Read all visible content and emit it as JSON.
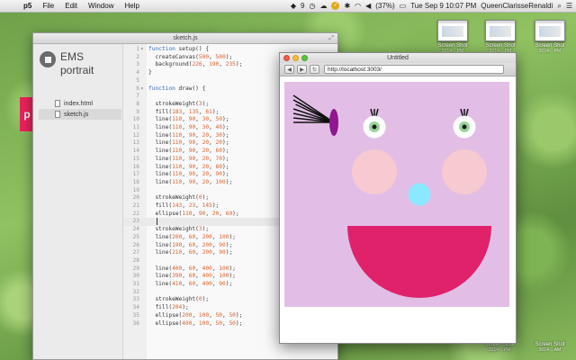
{
  "menubar": {
    "apple": "",
    "app_name": "p5",
    "items": [
      "File",
      "Edit",
      "Window",
      "Help"
    ],
    "status": {
      "dropbox": "9",
      "battery": "(37%)",
      "clock": "Tue Sep 9  10:07 PM",
      "user": "QueenClarisseRenaldi"
    }
  },
  "desktop_files": [
    {
      "label": "Screen Shot",
      "sub": "2014-...PM"
    },
    {
      "label": "Screen Shot",
      "sub": "2014-...PM"
    },
    {
      "label": "Screen Shot",
      "sub": "2014-...PM"
    },
    {
      "label": "Screen Shot",
      "sub": "2014-...PM"
    },
    {
      "label": "Screen Shot",
      "sub": "2014-...AM"
    }
  ],
  "dock": {
    "p5_letter": "p"
  },
  "editor": {
    "window_title": "sketch.js",
    "project_name_line1": "EMS",
    "project_name_line2": "portrait",
    "files": [
      {
        "name": "index.html",
        "selected": false
      },
      {
        "name": "sketch.js",
        "selected": true
      }
    ],
    "active_line": 23,
    "code": [
      {
        "n": "1",
        "fold": "▾",
        "text": "function setup() {"
      },
      {
        "n": "2",
        "fold": "",
        "text": "  createCanvas(500, 500);"
      },
      {
        "n": "3",
        "fold": "",
        "text": "  background(226, 190, 235);"
      },
      {
        "n": "4",
        "fold": "",
        "text": "}"
      },
      {
        "n": "5",
        "fold": "",
        "text": ""
      },
      {
        "n": "6",
        "fold": "▾",
        "text": "function draw() {"
      },
      {
        "n": "7",
        "fold": "",
        "text": ""
      },
      {
        "n": "8",
        "fold": "",
        "text": "  strokeWeight(3);"
      },
      {
        "n": "9",
        "fold": "",
        "text": "  fill(183, 135, 61);"
      },
      {
        "n": "10",
        "fold": "",
        "text": "  line(110, 90, 30, 50);"
      },
      {
        "n": "11",
        "fold": "",
        "text": "  line(110, 90, 30, 40);"
      },
      {
        "n": "12",
        "fold": "",
        "text": "  line(110, 90, 20, 30);"
      },
      {
        "n": "13",
        "fold": "",
        "text": "  line(110, 90, 20, 20);"
      },
      {
        "n": "14",
        "fold": "",
        "text": "  line(110, 90, 20, 60);"
      },
      {
        "n": "15",
        "fold": "",
        "text": "  line(110, 90, 20, 70);"
      },
      {
        "n": "16",
        "fold": "",
        "text": "  line(110, 90, 20, 80);"
      },
      {
        "n": "17",
        "fold": "",
        "text": "  line(110, 90, 20, 90);"
      },
      {
        "n": "18",
        "fold": "",
        "text": "  line(110, 90, 20, 100);"
      },
      {
        "n": "19",
        "fold": "",
        "text": ""
      },
      {
        "n": "20",
        "fold": "",
        "text": "  strokeWeight(0);"
      },
      {
        "n": "21",
        "fold": "",
        "text": "  fill(143, 23, 145);"
      },
      {
        "n": "22",
        "fold": "",
        "text": "  ellipse(110, 90, 20, 60);"
      },
      {
        "n": "23",
        "fold": "",
        "text": "  "
      },
      {
        "n": "24",
        "fold": "",
        "text": "  strokeWeight(3);"
      },
      {
        "n": "25",
        "fold": "",
        "text": "  line(200, 60, 200, 100);"
      },
      {
        "n": "26",
        "fold": "",
        "text": "  line(190, 60, 200, 90);"
      },
      {
        "n": "27",
        "fold": "",
        "text": "  line(210, 60, 200, 90);"
      },
      {
        "n": "28",
        "fold": "",
        "text": ""
      },
      {
        "n": "29",
        "fold": "",
        "text": "  line(400, 60, 400, 100);"
      },
      {
        "n": "30",
        "fold": "",
        "text": "  line(390, 60, 400, 100);"
      },
      {
        "n": "31",
        "fold": "",
        "text": "  line(410, 60, 400, 90);"
      },
      {
        "n": "32",
        "fold": "",
        "text": ""
      },
      {
        "n": "33",
        "fold": "",
        "text": "  strokeWeight(0);"
      },
      {
        "n": "34",
        "fold": "",
        "text": "  fill(204);"
      },
      {
        "n": "35",
        "fold": "",
        "text": "  ellipse(200, 100, 50, 50);"
      },
      {
        "n": "36",
        "fold": "",
        "text": "  ellipse(400, 100, 50, 50);"
      }
    ]
  },
  "browser": {
    "window_title": "Untitled",
    "url": "http://localhost:3003/",
    "back_icon": "◀",
    "forward_icon": "▶",
    "reload_icon": "↻",
    "sketch": {
      "background": "#e2bee6",
      "lash_color": "#111111",
      "lash_bow": "#8f1791",
      "eye_white": "#ffffff",
      "iris": "#9bd39b",
      "pupil": "#1a1a1a",
      "cheek": "#f7c9d0",
      "nose": "#8be8ff",
      "mouth": "#e0226b"
    }
  },
  "colors": {
    "p5_pink": "#ed225d",
    "keyword_blue": "#2e6fb0",
    "number_orange": "#d9622b"
  }
}
